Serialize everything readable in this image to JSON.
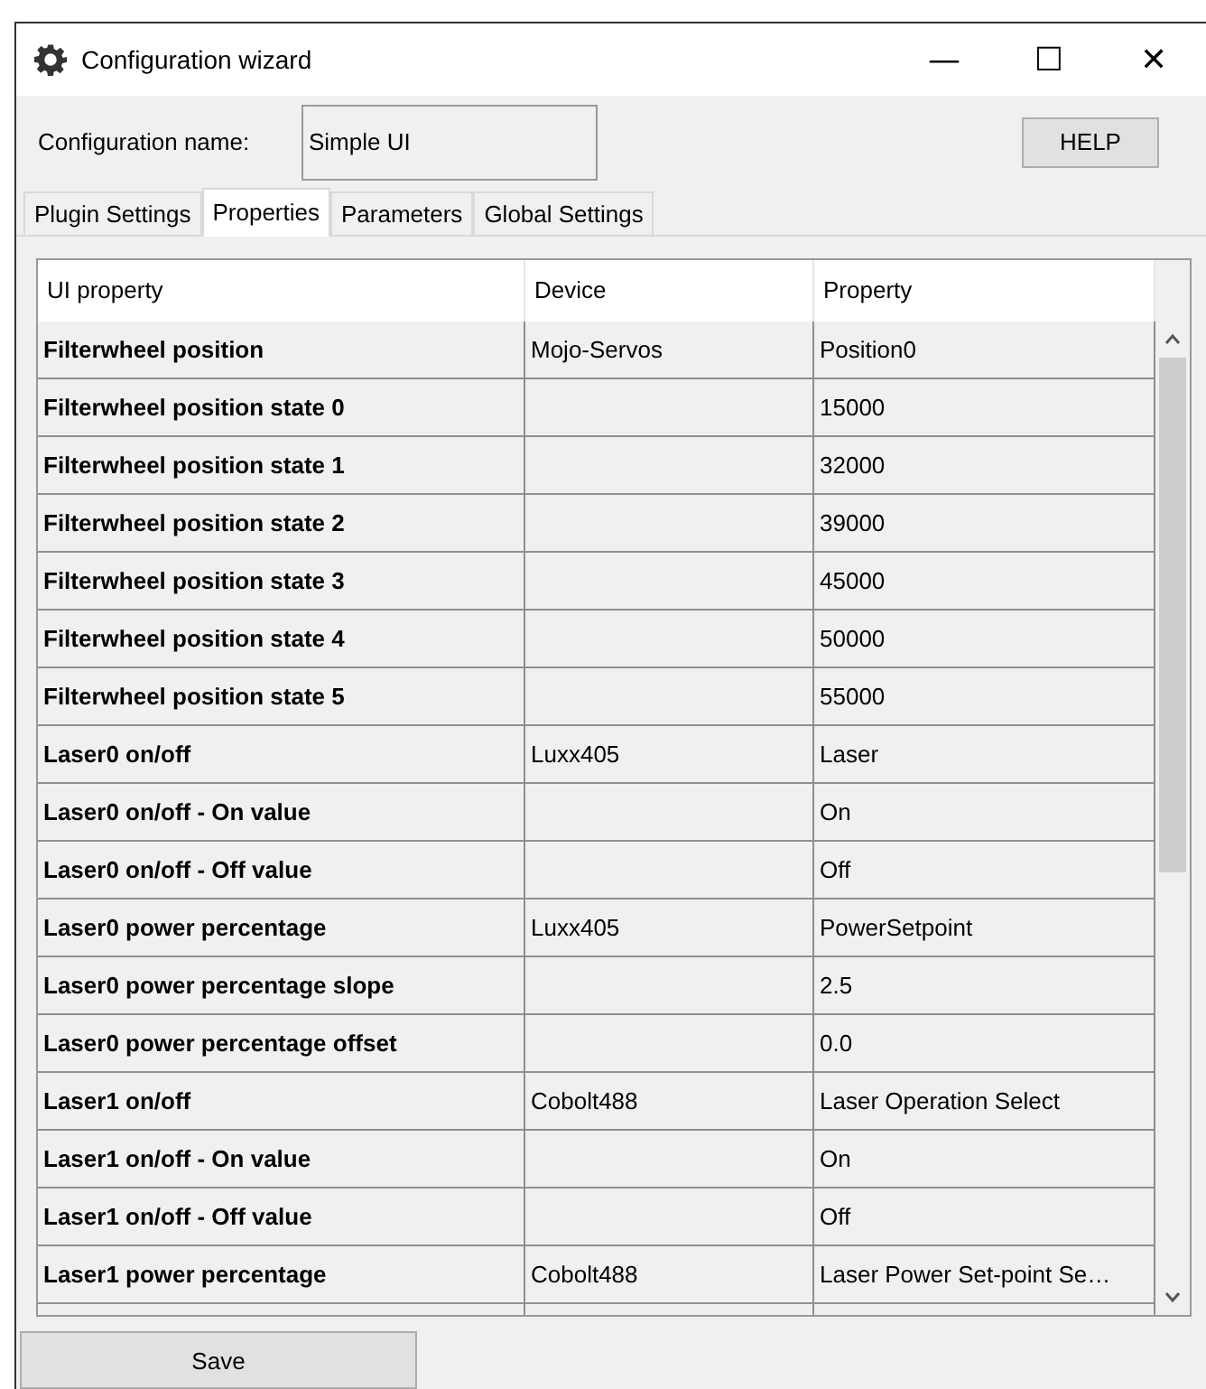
{
  "window": {
    "title": "Configuration wizard",
    "controls": [
      "—",
      "☐",
      "✕"
    ]
  },
  "config": {
    "label": "Configuration name:",
    "value": "Simple UI",
    "help": "HELP"
  },
  "tabs": [
    {
      "label": "Plugin Settings",
      "selected": false
    },
    {
      "label": "Properties",
      "selected": true
    },
    {
      "label": "Parameters",
      "selected": false
    },
    {
      "label": "Global Settings",
      "selected": false
    }
  ],
  "table": {
    "columns": [
      "UI property",
      "Device",
      "Property"
    ],
    "rows": [
      [
        "Filterwheel position",
        "Mojo-Servos",
        "Position0"
      ],
      [
        "Filterwheel position state 0",
        "",
        "15000"
      ],
      [
        "Filterwheel position state 1",
        "",
        "32000"
      ],
      [
        "Filterwheel position state 2",
        "",
        "39000"
      ],
      [
        "Filterwheel position state 3",
        "",
        "45000"
      ],
      [
        "Filterwheel position state 4",
        "",
        "50000"
      ],
      [
        "Filterwheel position state 5",
        "",
        "55000"
      ],
      [
        "Laser0 on/off",
        "Luxx405",
        "Laser"
      ],
      [
        "Laser0 on/off - On value",
        "",
        "On"
      ],
      [
        "Laser0 on/off - Off value",
        "",
        "Off"
      ],
      [
        "Laser0 power percentage",
        "Luxx405",
        "PowerSetpoint"
      ],
      [
        "Laser0 power percentage slope",
        "",
        "2.5"
      ],
      [
        "Laser0 power percentage offset",
        "",
        "0.0"
      ],
      [
        "Laser1 on/off",
        "Cobolt488",
        "Laser Operation Select"
      ],
      [
        "Laser1 on/off - On value",
        "",
        "On"
      ],
      [
        "Laser1 on/off - Off value",
        "",
        "Off"
      ],
      [
        "Laser1 power percentage",
        "Cobolt488",
        "Laser Power Set-point Se…"
      ]
    ]
  },
  "save": "Save"
}
